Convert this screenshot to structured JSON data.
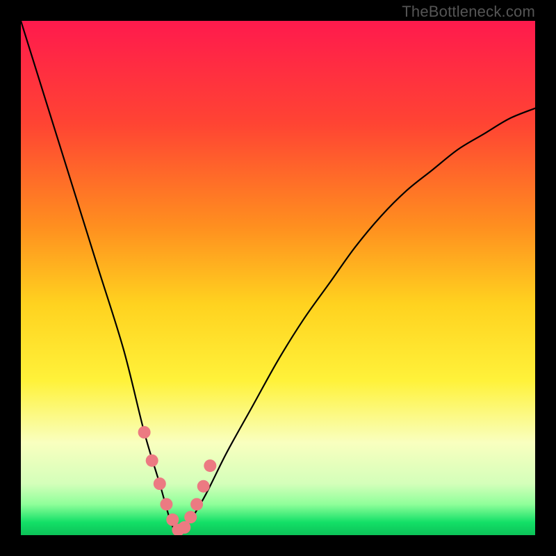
{
  "watermark": "TheBottleneck.com",
  "chart_data": {
    "type": "line",
    "title": "",
    "xlabel": "",
    "ylabel": "",
    "xlim": [
      0,
      100
    ],
    "ylim": [
      0,
      100
    ],
    "note": "Bottleneck percentage curve; minimum (~0%) around x≈30. Values are visual estimates from unlabeled axes.",
    "series": [
      {
        "name": "bottleneck-curve",
        "x": [
          0,
          5,
          10,
          15,
          20,
          24,
          27,
          29,
          30,
          31,
          33,
          36,
          40,
          45,
          50,
          55,
          60,
          65,
          70,
          75,
          80,
          85,
          90,
          95,
          100
        ],
        "values": [
          100,
          84,
          68,
          52,
          36,
          20,
          10,
          3,
          1,
          1,
          3,
          8,
          16,
          25,
          34,
          42,
          49,
          56,
          62,
          67,
          71,
          75,
          78,
          81,
          83
        ]
      }
    ],
    "marker_points": {
      "name": "highlight-dots",
      "color": "#ec7a82",
      "x": [
        24.0,
        25.5,
        27.0,
        28.3,
        29.5,
        30.6,
        31.8,
        33.0,
        34.2,
        35.5,
        36.8
      ],
      "values": [
        20.0,
        14.5,
        10.0,
        6.0,
        3.0,
        1.0,
        1.5,
        3.5,
        6.0,
        9.5,
        13.5
      ]
    },
    "background_gradient": {
      "stops": [
        {
          "offset": 0.0,
          "color": "#ff1a4d"
        },
        {
          "offset": 0.2,
          "color": "#ff4433"
        },
        {
          "offset": 0.4,
          "color": "#ff8f1f"
        },
        {
          "offset": 0.55,
          "color": "#ffd21f"
        },
        {
          "offset": 0.7,
          "color": "#fff23a"
        },
        {
          "offset": 0.82,
          "color": "#f9ffbf"
        },
        {
          "offset": 0.9,
          "color": "#d4ffba"
        },
        {
          "offset": 0.94,
          "color": "#8fff9a"
        },
        {
          "offset": 0.975,
          "color": "#13e067"
        },
        {
          "offset": 1.0,
          "color": "#0cc258"
        }
      ]
    }
  }
}
